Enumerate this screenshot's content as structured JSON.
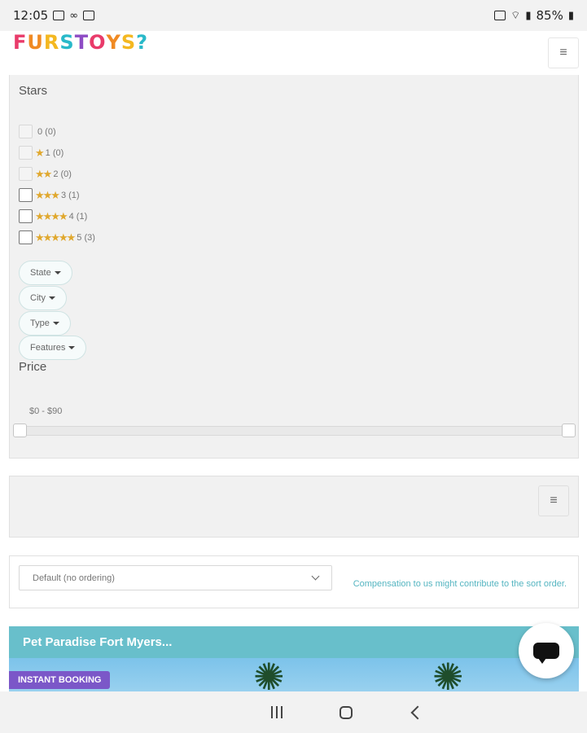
{
  "status_bar": {
    "time": "12:05",
    "battery": "85%"
  },
  "header": {
    "logo_text": "FURSTOYS?",
    "logo_colors": [
      "#e93b6a",
      "#f08a23",
      "#f4b821",
      "#29b9c9",
      "#8e4bc4"
    ]
  },
  "filters": {
    "stars_title": "Stars",
    "star_options": [
      {
        "label": "0 (0)",
        "stars": "",
        "enabled": false
      },
      {
        "label": "1 (0)",
        "stars": "★",
        "enabled": false
      },
      {
        "label": "2 (0)",
        "stars": "★★",
        "enabled": false
      },
      {
        "label": "3 (1)",
        "stars": "★★★",
        "enabled": true
      },
      {
        "label": "4 (1)",
        "stars": "★★★★",
        "enabled": true
      },
      {
        "label": "5 (3)",
        "stars": "★★★★★",
        "enabled": true
      }
    ],
    "dropdowns": [
      "State",
      "City",
      "Type",
      "Features"
    ],
    "price_title": "Price",
    "price_range": "$0 - $90",
    "price_min": 0,
    "price_max": 90
  },
  "sort": {
    "selected": "Default (no ordering)",
    "note": "Compensation to us might contribute to the sort order."
  },
  "listing": {
    "title": "Pet Paradise Fort Myers...",
    "badge": "INSTANT BOOKING"
  },
  "colors": {
    "accent_teal": "#68bfcb",
    "badge_purple": "#7b57c8",
    "star_gold": "#e0a82e"
  },
  "icons": {
    "menu": "hamburger-icon",
    "chat": "chat-icon"
  }
}
